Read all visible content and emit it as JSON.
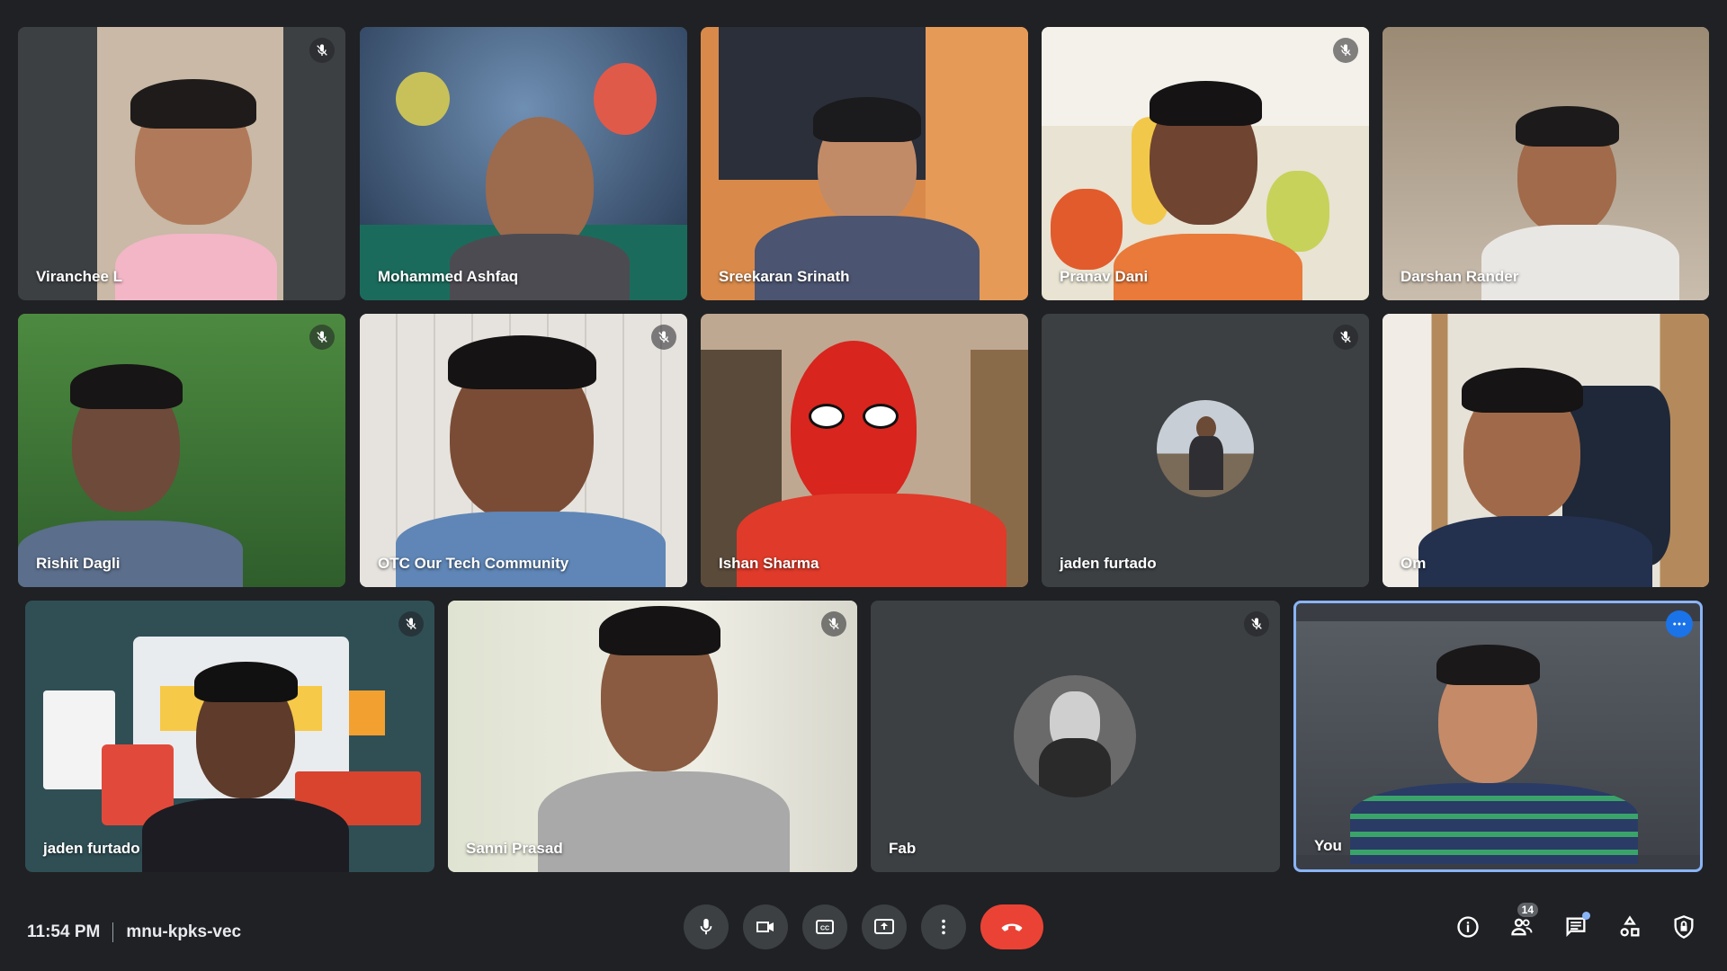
{
  "participants": [
    {
      "name": "Viranchee L",
      "muted": true
    },
    {
      "name": "Mohammed Ashfaq",
      "muted": false
    },
    {
      "name": "Sreekaran Srinath",
      "muted": false
    },
    {
      "name": "Pranav Dani",
      "muted": true
    },
    {
      "name": "Darshan Rander",
      "muted": false
    },
    {
      "name": "Rishit Dagli",
      "muted": true
    },
    {
      "name": "OTC Our Tech Community",
      "muted": true
    },
    {
      "name": "Ishan Sharma",
      "muted": false
    },
    {
      "name": "jaden furtado",
      "muted": true
    },
    {
      "name": "Om",
      "muted": false
    },
    {
      "name": "jaden furtado",
      "muted": true
    },
    {
      "name": "Sanni Prasad",
      "muted": true
    },
    {
      "name": "Fab",
      "muted": true
    },
    {
      "name": "You",
      "muted": false
    }
  ],
  "meeting": {
    "time": "11:54 PM",
    "code": "mnu-kpks-vec"
  },
  "controls": {
    "participant_count": "14"
  },
  "colors": {
    "background": "#202124",
    "tile": "#3c4043",
    "end_call": "#ea4335",
    "accent": "#8ab4f8",
    "self_menu": "#1a73e8"
  },
  "icons": {
    "mute": "mic-off-icon",
    "mic": "mic-icon",
    "camera": "videocam-icon",
    "captions": "closed-caption-icon",
    "present": "present-screen-icon",
    "more": "more-vert-icon",
    "end": "call-end-icon",
    "info": "info-icon",
    "people": "people-icon",
    "chat": "chat-icon",
    "activities": "activities-icon",
    "host": "host-controls-icon"
  }
}
